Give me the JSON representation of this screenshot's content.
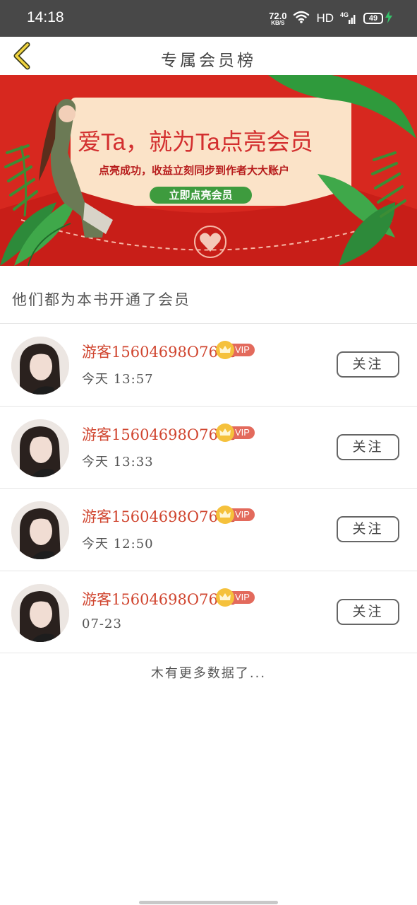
{
  "status_bar": {
    "time": "14:18",
    "net_speed_value": "72.0",
    "net_speed_unit": "KB/S",
    "hd": "HD",
    "signal": "4G",
    "battery": "49"
  },
  "header": {
    "title": "专属会员榜",
    "back_icon": "chevron-left-icon"
  },
  "banner": {
    "title": "爱Ta，就为Ta点亮会员",
    "subtitle": "点亮成功，收益立刻同步到作者大大账户",
    "button": "立即点亮会员"
  },
  "section_title": "他们都为本书开通了会员",
  "members": [
    {
      "name": "游客15604698O7668",
      "vip": "VIP",
      "time": "今天 13:57",
      "follow": "关注"
    },
    {
      "name": "游客15604698O7668",
      "vip": "VIP",
      "time": "今天 13:33",
      "follow": "关注"
    },
    {
      "name": "游客15604698O7668",
      "vip": "VIP",
      "time": "今天 12:50",
      "follow": "关注"
    },
    {
      "name": "游客15604698O7668",
      "vip": "VIP",
      "time": "07-23",
      "follow": "关注"
    }
  ],
  "footer_text": "木有更多数据了...",
  "colors": {
    "accent_red": "#d0452f",
    "banner_red": "#d7281f",
    "banner_green": "#3e9b3e",
    "vip_gold": "#f5c13c"
  }
}
